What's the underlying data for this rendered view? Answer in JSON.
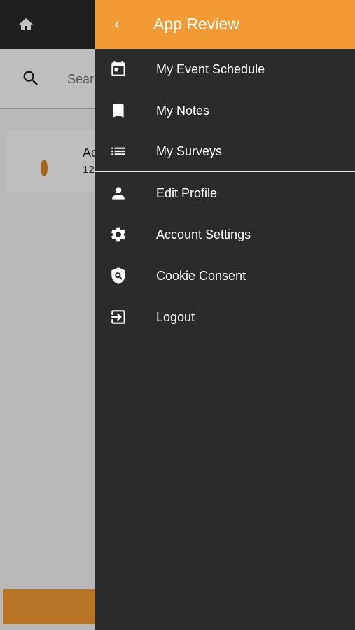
{
  "background": {
    "search": {
      "placeholder": "Search"
    },
    "card": {
      "title": "Ac",
      "subtitle": "12"
    }
  },
  "drawer": {
    "title": "App Review",
    "items": [
      {
        "label": "My Event Schedule",
        "icon": "calendar-icon"
      },
      {
        "label": "My Notes",
        "icon": "bookmark-icon"
      },
      {
        "label": "My Surveys",
        "icon": "list-icon"
      },
      {
        "label": "Edit Profile",
        "icon": "person-icon"
      },
      {
        "label": "Account Settings",
        "icon": "gear-icon"
      },
      {
        "label": "Cookie Consent",
        "icon": "shield-search-icon"
      },
      {
        "label": "Logout",
        "icon": "logout-icon"
      }
    ]
  },
  "colors": {
    "accent": "#F29A34",
    "drawer_background": "#2B2B2B",
    "topbar": "#2A2A2A",
    "text_on_dark": "#FFFFFF"
  }
}
